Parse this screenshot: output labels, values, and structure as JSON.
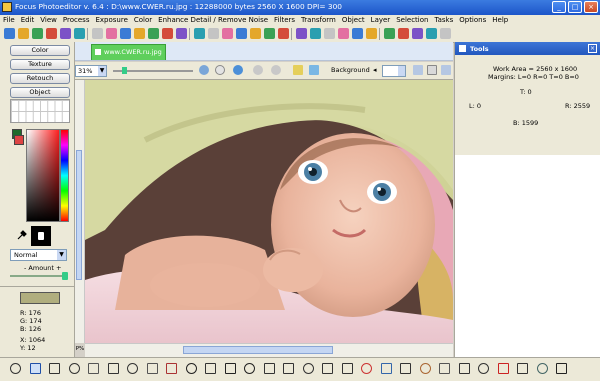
{
  "window": {
    "title": "Focus Photoeditor v. 6.4 :  D:\\www.CWER.ru.jpg : 12288000 bytes    2560 X 1600 DPI= 300",
    "minimize": "_",
    "maximize": "□",
    "close": "×"
  },
  "menu": [
    "File",
    "Edit",
    "View",
    "Process",
    "Exposure",
    "Color",
    "Enhance Detail / Remove Noise",
    "Filters",
    "Transform",
    "Object",
    "Layer",
    "Selection",
    "Tasks",
    "Options",
    "Help"
  ],
  "left_panel": {
    "buttons": [
      "Color",
      "Texture",
      "Retouch",
      "Object"
    ],
    "blend_mode": "Normal",
    "amount_label": "- Amount +",
    "amount_value": 1.0,
    "sample": {
      "R": "R: 176",
      "G": "G: 174",
      "B": "B: 126",
      "X": "X: 1064",
      "Y": "Y: 12"
    }
  },
  "document": {
    "tab_label": "www.CWER.ru.jpg",
    "zoom": "31%",
    "zoom_position": 0.12,
    "background_label": "Background",
    "px_label": "P%"
  },
  "tools_panel": {
    "title": "Tools",
    "work_area": "Work Area = 2560 x 1600",
    "margins": "Margins: L=0 R=0 T=0 B=0",
    "top": "T: 0",
    "left": "L: 0",
    "right": "R: 2559",
    "bottom": "B: 1599"
  },
  "colors": {
    "accent": "#1c55c9",
    "tab_green": "#5fcf5c",
    "sample_swatch": "#b0ae7e"
  },
  "icons": {
    "toolbar": [
      "new-icon",
      "open-icon",
      "save-icon",
      "print-icon",
      "undo-icon",
      "redo-icon",
      "crop-icon",
      "resize-icon",
      "rotate-icon",
      "histogram-icon",
      "levels-icon",
      "curves-icon",
      "color-balance-icon",
      "sharpen-icon",
      "blur-icon",
      "effects-icon",
      "frame-icon",
      "text-icon",
      "layers-icon",
      "mask-icon",
      "selection-icon",
      "clone-icon",
      "heal-icon",
      "redeye-icon",
      "brush-icon",
      "palette-icon",
      "compare-icon",
      "grid-icon",
      "plugin-icon",
      "fullscreen-icon",
      "help-icon"
    ],
    "bottom_tools": [
      "select-tool-icon",
      "marquee-tool-icon",
      "move-tool-icon",
      "zoom-tool-icon",
      "hand-tool-icon",
      "lasso-tool-icon",
      "magic-wand-tool-icon",
      "shape-rect-tool-icon",
      "eyedropper-tool-icon",
      "text-tool-icon",
      "brush-tool-icon",
      "line-tool-icon",
      "arrow-tool-icon",
      "ellipse-tool-icon",
      "rectangle-tool-icon",
      "rounded-rect-tool-icon",
      "polygon-tool-icon",
      "spline-tool-icon",
      "fill-tool-icon",
      "gradient-tool-icon",
      "eraser-tool-icon",
      "clone-stamp-tool-icon",
      "smudge-tool-icon",
      "dodge-tool-icon",
      "burn-tool-icon",
      "redeye-tool-icon",
      "sharpen-tool-icon",
      "stamp-tool-icon",
      "person-tool-icon"
    ]
  }
}
